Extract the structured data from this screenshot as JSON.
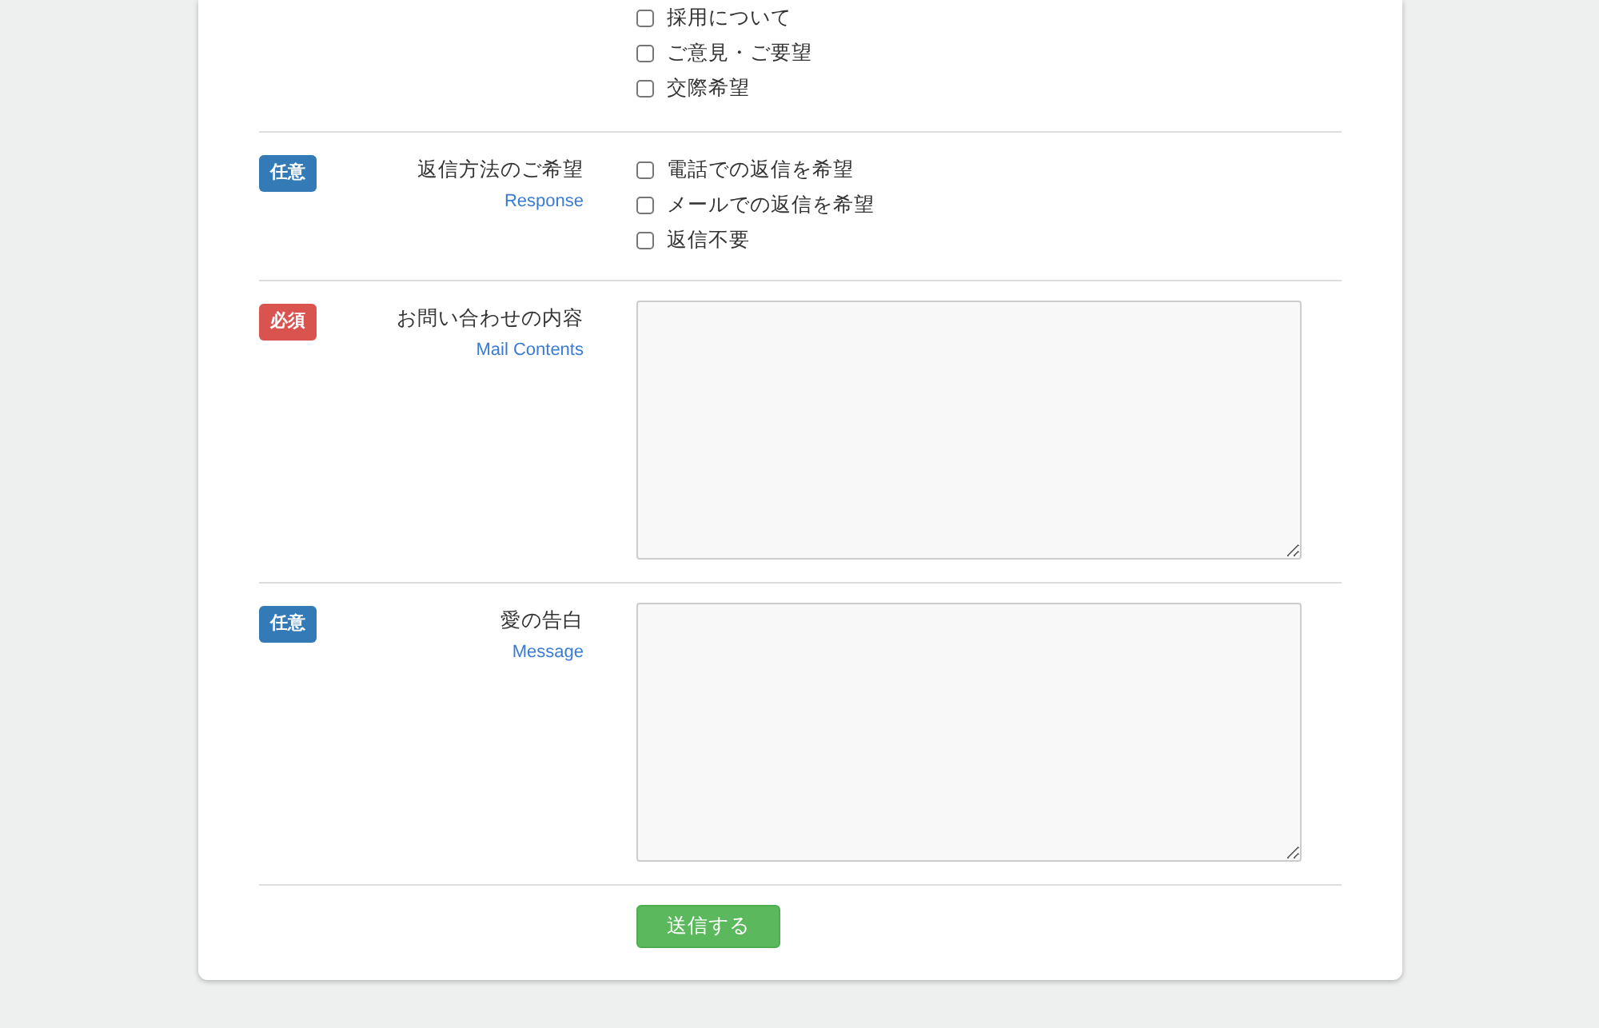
{
  "sections": [
    {
      "kind": "checkboxes",
      "options": [
        {
          "label": "採用について",
          "checked": false
        },
        {
          "label": "ご意見・ご要望",
          "checked": false
        },
        {
          "label": "交際希望",
          "checked": false
        }
      ]
    },
    {
      "kind": "checkboxes",
      "badge": {
        "text": "任意",
        "required": false
      },
      "label": "返信方法のご希望",
      "sublabel": "Response",
      "options": [
        {
          "label": "電話での返信を希望",
          "checked": false
        },
        {
          "label": "メールでの返信を希望",
          "checked": false
        },
        {
          "label": "返信不要",
          "checked": false
        }
      ]
    },
    {
      "kind": "textarea",
      "badge": {
        "text": "必須",
        "required": true
      },
      "label": "お問い合わせの内容",
      "sublabel": "Mail Contents"
    },
    {
      "kind": "textarea",
      "badge": {
        "text": "任意",
        "required": false
      },
      "label": "愛の告白",
      "sublabel": "Message"
    }
  ],
  "submit": "送信する"
}
